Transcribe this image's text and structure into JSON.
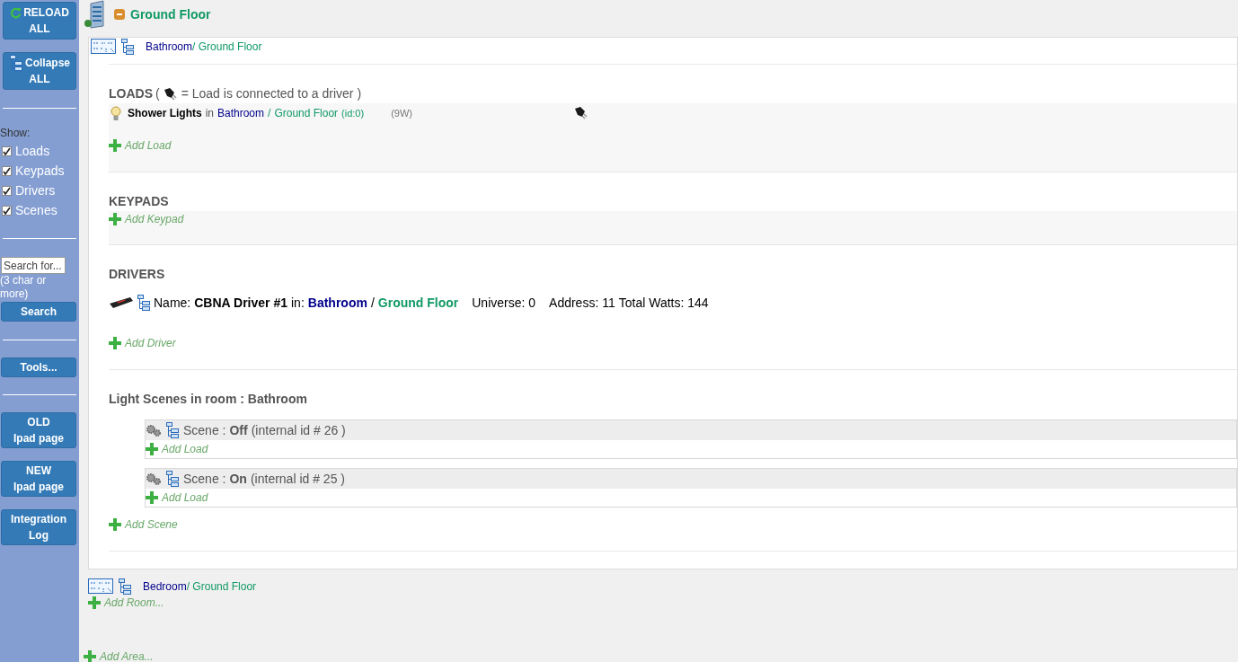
{
  "sidebar": {
    "top_buttons": [
      {
        "kind": "reload",
        "lines": [
          "RELOAD",
          "ALL"
        ]
      },
      {
        "kind": "collapse",
        "lines": [
          "Collapse",
          "ALL"
        ]
      }
    ],
    "show_label": "Show:",
    "filters": [
      {
        "label": "Loads",
        "checked": true
      },
      {
        "label": "Keypads",
        "checked": true
      },
      {
        "label": "Drivers",
        "checked": true
      },
      {
        "label": "Scenes",
        "checked": true
      }
    ],
    "search": {
      "placeholder": "Search for...",
      "hint": "(3 char or more)",
      "button": "Search"
    },
    "tools": "Tools...",
    "nav_buttons": [
      [
        "OLD",
        "Ipad page"
      ],
      [
        "NEW",
        "Ipad page"
      ],
      [
        "Integration",
        "Log"
      ]
    ]
  },
  "area": {
    "title": "Ground Floor",
    "expanded": true,
    "rooms": [
      {
        "name": "Bathroom",
        "floor": "/ Ground Floor",
        "expanded": true,
        "loads": {
          "heading": "LOADS",
          "legend_open": "(",
          "legend_text": "= Load is connected to a driver )",
          "items": [
            {
              "name": "Shower Lights",
              "in": "in",
              "room": "Bathroom",
              "sep": "/",
              "floor": "Ground Floor",
              "id": "(id:0)",
              "watts": "(9W)",
              "connected": true
            }
          ],
          "add": "Add Load"
        },
        "keypads": {
          "heading": "KEYPADS",
          "add": "Add Keypad"
        },
        "drivers": {
          "heading": "DRIVERS",
          "items": [
            {
              "name_label": "Name:",
              "name": "CBNA Driver #1",
              "in_label": "in:",
              "room": "Bathroom",
              "sep": "/",
              "floor": "Ground Floor",
              "universe": "Universe: 0",
              "address": "Address: 11",
              "watts": "Total Watts: 144"
            }
          ],
          "add": "Add Driver"
        },
        "scenes": {
          "heading": "Light Scenes in room : Bathroom",
          "items": [
            {
              "label": "Scene :",
              "name": "Off",
              "internal": "(internal id # 26 )",
              "add": "Add Load"
            },
            {
              "label": "Scene :",
              "name": "On",
              "internal": "(internal id # 25 )",
              "add": "Add Load"
            }
          ],
          "add": "Add Scene"
        }
      },
      {
        "name": "Bedroom",
        "floor": "/ Ground Floor",
        "expanded": false
      }
    ],
    "add_room": "Add Room..."
  },
  "add_area": "Add Area..."
}
